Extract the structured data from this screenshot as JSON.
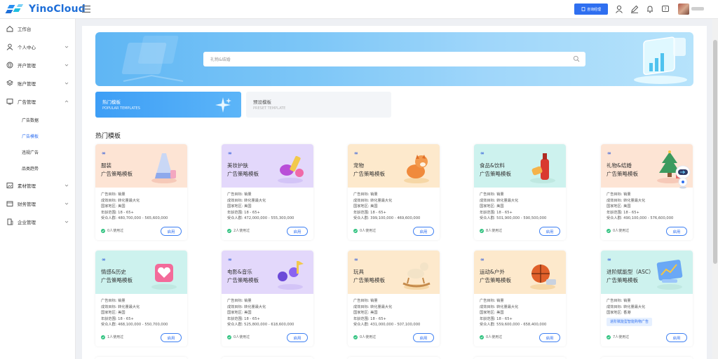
{
  "app": {
    "logo_text": "YinoCloud"
  },
  "header": {
    "consult_label": "咨询经理"
  },
  "sidebar": {
    "items": [
      {
        "label": "工作台",
        "icon": "home-icon"
      },
      {
        "label": "个人中心",
        "icon": "user-icon"
      },
      {
        "label": "开户管理",
        "icon": "account-open-icon"
      },
      {
        "label": "账户管理",
        "icon": "layers-icon"
      },
      {
        "label": "广告管理",
        "icon": "ad-icon"
      },
      {
        "label": "素材管理",
        "icon": "image-icon"
      },
      {
        "label": "财务管理",
        "icon": "wallet-icon"
      },
      {
        "label": "企业管理",
        "icon": "building-icon"
      }
    ],
    "sub_items": [
      "广告数据",
      "广告模板",
      "违规广告",
      "品类趋势"
    ],
    "active_sub": "广告模板"
  },
  "search": {
    "placeholder": "礼物&结婚"
  },
  "tabs": [
    {
      "title": "热门模板",
      "subtitle": "POPULAR TEMPLATES"
    },
    {
      "title": "预设模板",
      "subtitle": "PRESET TEMPLATE"
    }
  ],
  "section_title": "热门模板",
  "labels": {
    "goal": "广告目标:",
    "conversion": "成效目标:",
    "country": "国家地区:",
    "age": "年龄范围:",
    "audience": "受众人群:",
    "use_button": "启用"
  },
  "cards": [
    {
      "name": "服装",
      "subtitle": "广告策略模板",
      "goal": "销量",
      "conversion": "转化量最大化",
      "country": "美国",
      "age": "18 - 65+",
      "audience": "480,700,000 - 565,600,000",
      "used": "0人使用过",
      "theme": "#fde4d4",
      "icon": "dress-icon"
    },
    {
      "name": "美妆护肤",
      "subtitle": "广告策略模板",
      "goal": "销量",
      "conversion": "转化量最大化",
      "country": "美国",
      "age": "18 - 65+",
      "audience": "472,000,000 - 555,300,000",
      "used": "2人使用过",
      "theme": "#e3d8fb",
      "icon": "cosmetics-icon"
    },
    {
      "name": "宠物",
      "subtitle": "广告策略模板",
      "goal": "销量",
      "conversion": "转化量最大化",
      "country": "美国",
      "age": "18 - 65+",
      "audience": "399,100,000 - 469,600,000",
      "used": "0人使用过",
      "theme": "#fde9cc",
      "icon": "dog-icon"
    },
    {
      "name": "食品&饮料",
      "subtitle": "广告策略模板",
      "goal": "销量",
      "conversion": "转化量最大化",
      "country": "美国",
      "age": "18 - 65+",
      "audience": "501,900,000 - 590,500,000",
      "used": "8人使用过",
      "theme": "#cdf2ee",
      "icon": "drink-icon"
    },
    {
      "name": "礼物&结婚",
      "subtitle": "广告策略模板",
      "goal": "销量",
      "conversion": "转化量最大化",
      "country": "美国",
      "age": "18 - 65+",
      "audience": "490,100,000 - 576,600,000",
      "used": "0人使用过",
      "theme": "#fde4d4",
      "icon": "gift-tree-icon"
    },
    {
      "name": "情感&历史",
      "subtitle": "广告策略模板",
      "goal": "销量",
      "conversion": "转化量最大化",
      "country": "美国",
      "age": "18 - 65+",
      "audience": "468,100,000 - 550,700,000",
      "used": "1人使用过",
      "theme": "#cdf2ee",
      "icon": "heart-box-icon"
    },
    {
      "name": "电影&音乐",
      "subtitle": "广告策略模板",
      "goal": "销量",
      "conversion": "转化量最大化",
      "country": "美国",
      "age": "18 - 65+",
      "audience": "525,800,000 - 618,600,000",
      "used": "0人使用过",
      "theme": "#e3d8fb",
      "icon": "music-icon"
    },
    {
      "name": "玩具",
      "subtitle": "广告策略模板",
      "goal": "销量",
      "conversion": "转化量最大化",
      "country": "美国",
      "age": "18 - 65+",
      "audience": "431,000,000 - 507,100,000",
      "used": "0人使用过",
      "theme": "#fde9cc",
      "icon": "rocking-horse-icon"
    },
    {
      "name": "运动&户外",
      "subtitle": "广告策略模板",
      "goal": "销量",
      "conversion": "转化量最大化",
      "country": "美国",
      "age": "18 - 65+",
      "audience": "559,600,000 - 658,400,000",
      "used": "0人使用过",
      "theme": "#fde9cc",
      "icon": "basketball-icon"
    },
    {
      "name": "进阶赋能型（ASC）",
      "subtitle": "广告策略模板",
      "goal": "销量",
      "conversion": "转化量最大化",
      "country": "香港",
      "age": "",
      "audience": "",
      "used": "7人使用过",
      "theme": "#cdf2ee",
      "icon": "chart-screen-icon",
      "asc_link": "进阶赋能型智能购物广告"
    }
  ]
}
